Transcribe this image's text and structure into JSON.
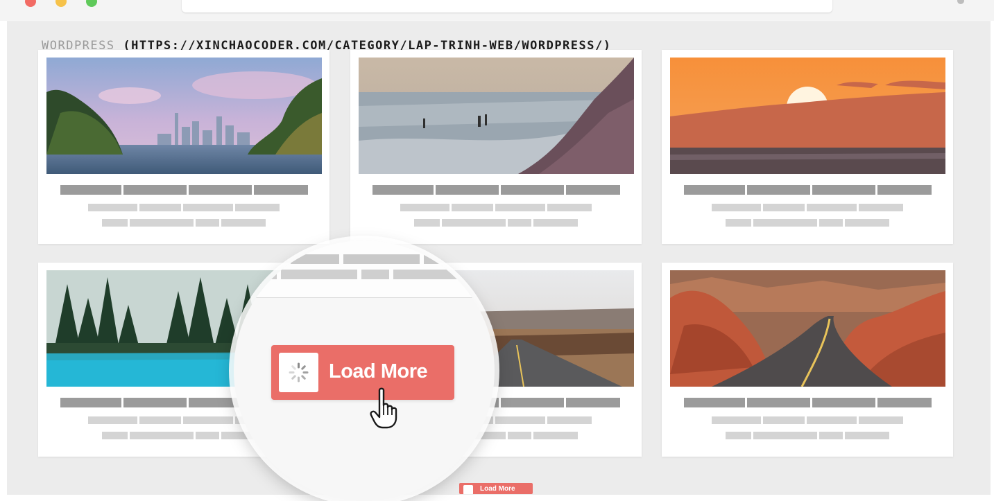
{
  "page": {
    "category_label": "WORDPRESS",
    "category_url": "(HTTPS://XINCHAOCODER.COM/CATEGORY/LAP-TRINH-WEB/WORDPRESS/)"
  },
  "cards": [
    {
      "image": "city-skyline-lake-photo"
    },
    {
      "image": "beach-shoreline-photo"
    },
    {
      "image": "orange-sunset-sea-photo"
    },
    {
      "image": "turquoise-lake-forest-photo"
    },
    {
      "image": "desert-highway-photo"
    },
    {
      "image": "red-rock-canyon-road-photo"
    }
  ],
  "load_more": {
    "label": "Load More",
    "icon": "loading-spinner-icon",
    "cursor": "hand-pointer-icon",
    "color": "#ea6e68"
  },
  "colors": {
    "background": "#ececec",
    "card": "#ffffff",
    "title_placeholder": "#9b9b9b",
    "text_placeholder": "#d4d4d4"
  }
}
